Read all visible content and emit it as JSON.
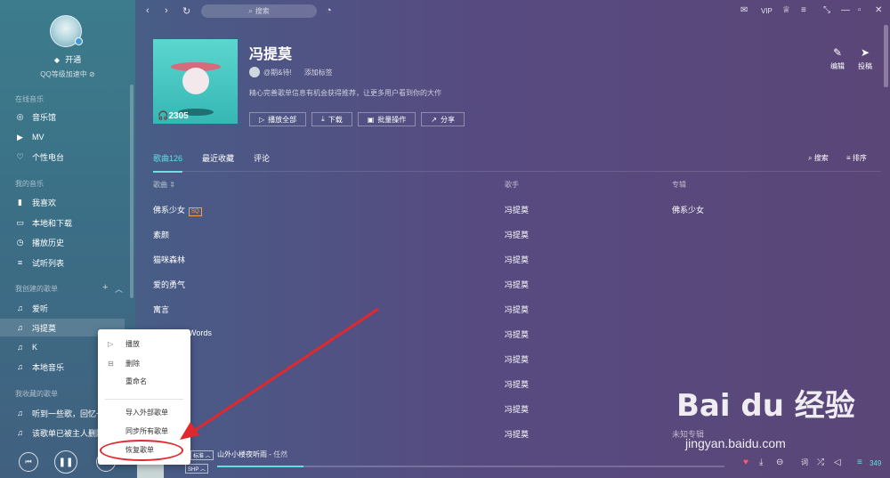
{
  "sidebar": {
    "vip_label": "开通",
    "level_text": "QQ等级加速中",
    "online_music_title": "在线音乐",
    "online_items": [
      {
        "label": "音乐馆",
        "icon": "music-hall-icon"
      },
      {
        "label": "MV",
        "icon": "mv-icon"
      },
      {
        "label": "个性电台",
        "icon": "radio-icon"
      }
    ],
    "my_music_title": "我的音乐",
    "my_items": [
      {
        "label": "我喜欢",
        "icon": "like-icon"
      },
      {
        "label": "本地和下载",
        "icon": "download-icon"
      },
      {
        "label": "播放历史",
        "icon": "history-icon"
      },
      {
        "label": "试听列表",
        "icon": "playlist-icon"
      }
    ],
    "created_title": "我创建的歌单",
    "created_items": [
      {
        "label": "爱听"
      },
      {
        "label": "冯提莫"
      },
      {
        "label": "K"
      },
      {
        "label": "本地音乐"
      }
    ],
    "collected_title": "我收藏的歌单",
    "collected_items": [
      {
        "label": "听到一些歌，回忆一"
      },
      {
        "label": "该歌单已被主人删除"
      }
    ]
  },
  "topbar": {
    "search_placeholder": "搜索",
    "vip_text": "VIP"
  },
  "playlist": {
    "title": "冯提莫",
    "owner": "@期&待!",
    "add_tag": "添加标签",
    "description": "精心完善歌单信息有机会获得推荐，让更多用户看到你的大作",
    "play_count": "2305",
    "actions": [
      "播放全部",
      "下载",
      "批量操作",
      "分享"
    ],
    "edit_label": "编辑",
    "submit_label": "投稿"
  },
  "tabs": [
    "歌曲126",
    "最近收藏",
    "评论"
  ],
  "tools": {
    "search": "搜索",
    "sort": "排序"
  },
  "table": {
    "headers": {
      "song": "歌曲",
      "singer": "歌手",
      "album": "专辑"
    },
    "rows": [
      {
        "song": "佛系少女",
        "singer": "冯提莫",
        "album": "佛系少女",
        "badge": "SQ"
      },
      {
        "song": "素颜",
        "singer": "冯提莫",
        "album": ""
      },
      {
        "song": "猫咪森林",
        "singer": "冯提莫",
        "album": ""
      },
      {
        "song": "爱的勇气",
        "singer": "冯提莫",
        "album": ""
      },
      {
        "song": "寓言",
        "singer": "冯提莫",
        "album": ""
      },
      {
        "song": "Words",
        "singer": "冯提莫",
        "album": ""
      },
      {
        "song": "",
        "singer": "冯提莫",
        "album": ""
      },
      {
        "song": "",
        "singer": "冯提莫",
        "album": ""
      },
      {
        "song": "",
        "singer": "冯提莫",
        "album": ""
      },
      {
        "song": "",
        "singer": "冯提莫",
        "album": "未知专辑"
      }
    ]
  },
  "context_menu": {
    "items": [
      "播放",
      "删除",
      "重命名"
    ],
    "items2": [
      "导入外部歌单",
      "同步所有歌单",
      "恢复歌单"
    ]
  },
  "player": {
    "song": "山外小楼夜听雨",
    "artist": "任然",
    "quality": "SHP",
    "quality2": "标准",
    "progress": 0.17,
    "playlist_count": "349"
  },
  "watermark": {
    "logo": "Bai du 经验",
    "url": "jingyan.baidu.com"
  },
  "colors": {
    "accent": "#5fe0e0",
    "annotation_red": "#e0282e",
    "heart": "#ff5a6a"
  }
}
